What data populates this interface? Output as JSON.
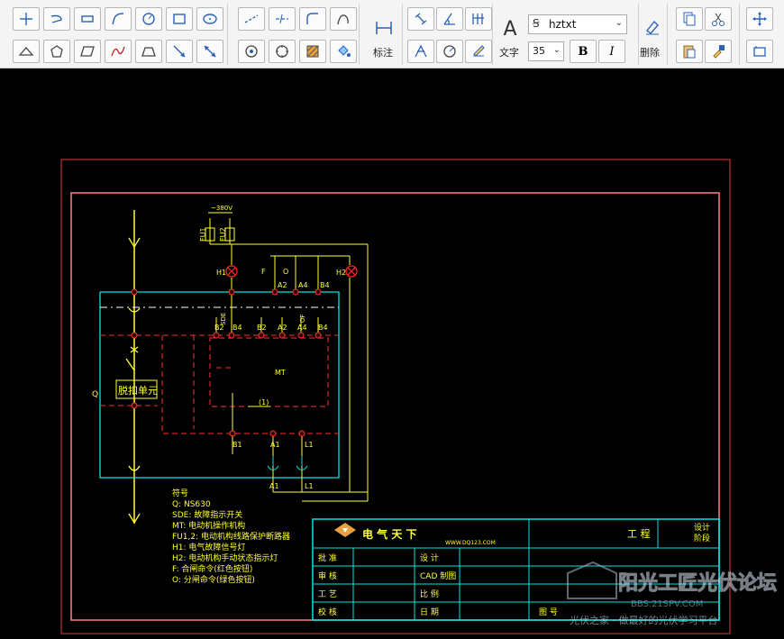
{
  "toolbar": {
    "draw_row1": [
      "polyline-tool-icon",
      "arc-polyline-tool-icon",
      "rectangle-dashed-tool-icon",
      "bend-line-tool-icon",
      "circle-tool-icon",
      "square-tool-icon",
      "ellipse-tool-icon"
    ],
    "draw_row2": [
      "triangle-tool-icon",
      "pentagon-tool-icon",
      "parallelogram-tool-icon",
      "curve-tool-icon",
      "trapezoid-tool-icon",
      "arrow-tool-icon",
      "double-arrow-tool-icon"
    ],
    "dimension_label": "标注",
    "text_label": "文字",
    "font_name": "hztxt",
    "font_size": "35",
    "bold_label": "B",
    "italic_label": "I",
    "delete_label": "删除"
  },
  "drawing": {
    "voltage": "~380V",
    "fu1": "FU1",
    "fu2": "FU2",
    "h1": "H1",
    "h2": "H2",
    "f": "F",
    "o": "O",
    "a2_top": "A2",
    "a4_top": "A4",
    "b4_top": "B4",
    "sde": "SDE",
    "of": "OF",
    "b2": "B2",
    "b4": "B4",
    "b2b": "B2",
    "a2": "A2",
    "a4": "A4",
    "b4b": "B4",
    "mt": "MT",
    "one": "(1)",
    "b1": "B1",
    "a1": "A1",
    "l1": "L1",
    "a1b": "A1",
    "l1b": "L1",
    "q": "Q",
    "release_unit": "脱扣单元",
    "legend": [
      "符号",
      "Q:     NS630",
      "SDE: 故障指示开关",
      "MT: 电动机操作机构",
      "FU1,2: 电动机构线路保护断路器",
      "H1: 电气故障信号灯",
      "H2: 电动机构手动状态指示灯",
      "F: 合闸命令(红色按钮)",
      "O: 分闸命令(绿色按钮)"
    ]
  },
  "title_block": {
    "company": "电 气 天 下",
    "website": "WWW.DQ123.COM",
    "project_label": "工 程",
    "design_stage": [
      "设计",
      "阶段"
    ],
    "rows": [
      [
        "批   准",
        "",
        "设   计",
        ""
      ],
      [
        "审   核",
        "",
        "CAD 制图",
        ""
      ],
      [
        "工   艺",
        "",
        "比   例",
        ""
      ],
      [
        "校   核",
        "",
        "日   期",
        ""
      ]
    ],
    "drawing_no_label": "图  号"
  },
  "watermark": {
    "main": "阳光工匠光伏论坛",
    "url": "BBS.21SPV.COM",
    "slogan": "光伏之家 · 做最好的光伏学习平台"
  },
  "colors": {
    "frame": "#ff8080",
    "frame_inner": "#e04040",
    "cyan": "#00e5e5",
    "yellow": "#ffff33",
    "orange": "#ff3333",
    "red": "#ff2020",
    "white": "#ffffff"
  }
}
